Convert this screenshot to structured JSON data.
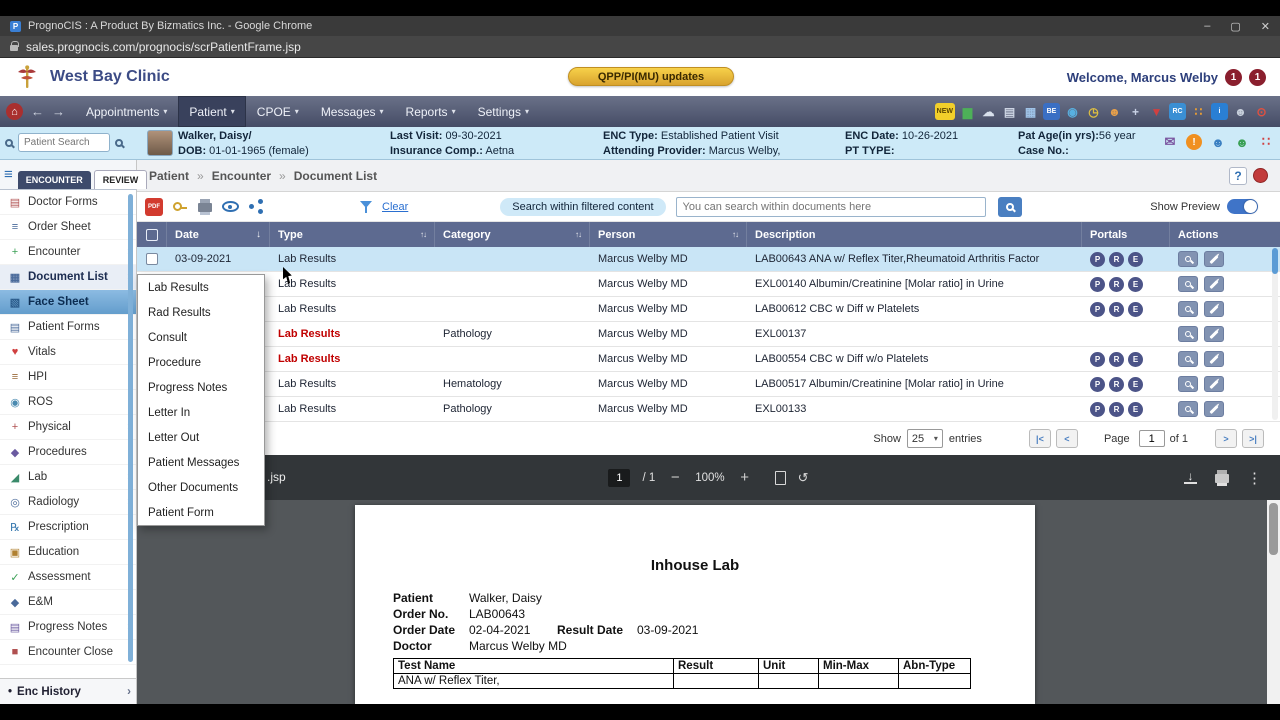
{
  "colors": {
    "brand_navy": "#3c4b85",
    "accent_blue": "#4a7fc1",
    "selection_blue": "#c9e5f6",
    "table_header": "#5d6a90",
    "alert_red": "#c00000",
    "portal_purple": "#4c5488",
    "qpp_yellow": "#e8b33a",
    "toggle_blue": "#3f74c8"
  },
  "chrome": {
    "title": "PrognoCIS : A Product By Bizmatics Inc. - Google Chrome",
    "url": "sales.prognocis.com/prognocis/scrPatientFrame.jsp",
    "minimize": "–",
    "maximize": "▢",
    "close": "✕"
  },
  "header": {
    "clinic_name": "West Bay Clinic",
    "qpp_button": "QPP/PI(MU) updates",
    "welcome": "Welcome, Marcus Welby",
    "badge1": "1",
    "badge2": "1"
  },
  "nav": {
    "items": [
      {
        "label": "Appointments",
        "active": false
      },
      {
        "label": "Patient",
        "active": true
      },
      {
        "label": "CPOE",
        "active": false
      },
      {
        "label": "Messages",
        "active": false
      },
      {
        "label": "Reports",
        "active": false
      },
      {
        "label": "Settings",
        "active": false
      }
    ],
    "icons": [
      {
        "name": "whats-new-icon",
        "glyph": "NEW",
        "color": "#5a4500",
        "bg": "#f2cf2a"
      },
      {
        "name": "charts-icon",
        "glyph": "▆",
        "color": "#4db058"
      },
      {
        "name": "cloud-icon",
        "glyph": "☁",
        "color": "#d8e0ec"
      },
      {
        "name": "compose-icon",
        "glyph": "▤",
        "color": "#cdd5e4"
      },
      {
        "name": "keyboard-icon",
        "glyph": "▦",
        "color": "#9fc3e8"
      },
      {
        "name": "billing-icon",
        "glyph": "BE",
        "color": "#ffffff",
        "bg": "#3a6fc4"
      },
      {
        "name": "globe-icon",
        "glyph": "◉",
        "color": "#58b0e0"
      },
      {
        "name": "clock-icon",
        "glyph": "◷",
        "color": "#e0c040"
      },
      {
        "name": "user-search-icon",
        "glyph": "☻",
        "color": "#e8a04a"
      },
      {
        "name": "immunization-icon",
        "glyph": "+",
        "color": "#c9d2e6"
      },
      {
        "name": "alert-icon",
        "glyph": "▼",
        "color": "#d04040"
      },
      {
        "name": "rcopia-icon",
        "glyph": "RC",
        "color": "#ffffff",
        "bg": "#3a8fd4"
      },
      {
        "name": "apps-icon",
        "glyph": "∷",
        "color": "#f0a030"
      },
      {
        "name": "info-icon",
        "glyph": "i",
        "color": "#ffffff",
        "bg": "#2a7fd4"
      },
      {
        "name": "support-icon",
        "glyph": "☻",
        "color": "#c8d0dc"
      },
      {
        "name": "logout-icon",
        "glyph": "⊙",
        "color": "#e05040"
      }
    ]
  },
  "patient_bar": {
    "search_placeholder": "Patient Search",
    "name": "Walker, Daisy/",
    "dob_label": "DOB:",
    "dob": "01-01-1965 (female)",
    "last_visit_label": "Last Visit:",
    "last_visit": "09-30-2021",
    "insurance_label": "Insurance Comp.:",
    "insurance": "Aetna",
    "enc_type_label": "ENC Type:",
    "enc_type": "Established Patient Visit",
    "attending_label": "Attending Provider:",
    "attending": "Marcus Welby,",
    "enc_date_label": "ENC Date:",
    "enc_date": "10-26-2021",
    "pt_type_label": "PT TYPE:",
    "pt_type": "",
    "pat_age_label": "Pat Age(in yrs):",
    "pat_age": "56 year",
    "case_no_label": "Case No.:",
    "case_no": "",
    "right_icons": [
      {
        "name": "fax-mail-icon",
        "glyph": "✉",
        "color": "#7a55a0"
      },
      {
        "name": "alerts-bell-icon",
        "glyph": "!",
        "color": "#ffffff",
        "bg": "#f09020"
      },
      {
        "name": "portal-user-icon",
        "glyph": "☻",
        "color": "#3a7fc1"
      },
      {
        "name": "add-user-icon",
        "glyph": "☻",
        "color": "#3aa055"
      },
      {
        "name": "quick-apps-icon",
        "glyph": "∷",
        "color": "#d04040"
      }
    ]
  },
  "sidebar": {
    "tabs": [
      "ENCOUNTER",
      "REVIEW"
    ],
    "items": [
      {
        "label": "Doctor Forms",
        "glyph": "▤",
        "color": "#b05050",
        "arrow": false,
        "selected": false,
        "highlight": false
      },
      {
        "label": "Order Sheet",
        "glyph": "≡",
        "color": "#4a6a9a",
        "arrow": false,
        "selected": false,
        "highlight": false
      },
      {
        "label": "Encounter",
        "glyph": "+",
        "color": "#3aa055",
        "arrow": true,
        "selected": false,
        "highlight": false
      },
      {
        "label": "Document List",
        "glyph": "▦",
        "color": "#4a6a9a",
        "arrow": true,
        "selected": true,
        "highlight": false
      },
      {
        "label": "Face Sheet",
        "glyph": "▧",
        "color": "#2a5a8a",
        "arrow": true,
        "selected": false,
        "highlight": true
      },
      {
        "label": "Patient Forms",
        "glyph": "▤",
        "color": "#4a6a9a",
        "arrow": false,
        "selected": false,
        "highlight": false
      },
      {
        "label": "Vitals",
        "glyph": "♥",
        "color": "#d04040",
        "arrow": false,
        "selected": false,
        "highlight": false
      },
      {
        "label": "HPI",
        "glyph": "≡",
        "color": "#9a6a3a",
        "arrow": false,
        "selected": false,
        "highlight": false
      },
      {
        "label": "ROS",
        "glyph": "◉",
        "color": "#4a8ab0",
        "arrow": false,
        "selected": false,
        "highlight": false
      },
      {
        "label": "Physical",
        "glyph": "+",
        "color": "#b05050",
        "arrow": true,
        "selected": false,
        "highlight": false
      },
      {
        "label": "Procedures",
        "glyph": "◆",
        "color": "#6a5aa0",
        "arrow": false,
        "selected": false,
        "highlight": false
      },
      {
        "label": "Lab",
        "glyph": "◢",
        "color": "#3a8a6a",
        "arrow": true,
        "selected": false,
        "highlight": false
      },
      {
        "label": "Radiology",
        "glyph": "◎",
        "color": "#4a6a9a",
        "arrow": true,
        "selected": false,
        "highlight": false
      },
      {
        "label": "Prescription",
        "glyph": "℞",
        "color": "#3a7ab0",
        "arrow": false,
        "selected": false,
        "highlight": false
      },
      {
        "label": "Education",
        "glyph": "▣",
        "color": "#b08030",
        "arrow": false,
        "selected": false,
        "highlight": false
      },
      {
        "label": "Assessment",
        "glyph": "✓",
        "color": "#3aa055",
        "arrow": false,
        "selected": false,
        "highlight": false
      },
      {
        "label": "E&M",
        "glyph": "◆",
        "color": "#4a6a9a",
        "arrow": false,
        "selected": false,
        "highlight": false
      },
      {
        "label": "Progress Notes",
        "glyph": "▤",
        "color": "#6a5aa0",
        "arrow": true,
        "selected": false,
        "highlight": false
      },
      {
        "label": "Encounter Close",
        "glyph": "■",
        "color": "#b05050",
        "arrow": false,
        "selected": false,
        "highlight": false
      }
    ],
    "enc_history": "Enc History"
  },
  "breadcrumb": {
    "parts": [
      "Patient",
      "Encounter",
      "Document List"
    ],
    "separator": "»",
    "help": "?"
  },
  "filter_bar": {
    "clear": "Clear",
    "search_label": "Search within filtered content",
    "search_placeholder": "You can search within documents here",
    "show_preview": "Show Preview"
  },
  "table": {
    "headers": [
      "Date",
      "Type",
      "Category",
      "Person",
      "Description",
      "Portals",
      "Actions"
    ],
    "portal_letters": [
      "P",
      "R",
      "E"
    ],
    "rows": [
      {
        "date": "03-09-2021",
        "type": "Lab Results",
        "category": "",
        "person": "Marcus Welby MD",
        "description": "LAB00643 ANA w/ Reflex Titer,Rheumatoid Arthritis Factor",
        "portals": true,
        "red": false,
        "selected": true
      },
      {
        "date": "",
        "type": "Lab Results",
        "category": "",
        "person": "Marcus Welby MD",
        "description": "EXL00140 Albumin/Creatinine [Molar ratio] in Urine",
        "portals": true,
        "red": false,
        "selected": false
      },
      {
        "date": "",
        "type": "Lab Results",
        "category": "",
        "person": "Marcus Welby MD",
        "description": "LAB00612 CBC w Diff w Platelets",
        "portals": true,
        "red": false,
        "selected": false
      },
      {
        "date": "",
        "type": "Lab Results",
        "category": "Pathology",
        "person": "Marcus Welby MD",
        "description": "EXL00137",
        "portals": false,
        "red": true,
        "selected": false
      },
      {
        "date": "",
        "type": "Lab Results",
        "category": "",
        "person": "Marcus Welby MD",
        "description": "LAB00554 CBC w Diff w/o Platelets",
        "portals": true,
        "red": true,
        "selected": false
      },
      {
        "date": "",
        "type": "Lab Results",
        "category": "Hematology",
        "person": "Marcus Welby MD",
        "description": "LAB00517 Albumin/Creatinine [Molar ratio] in Urine",
        "portals": true,
        "red": false,
        "selected": false
      },
      {
        "date": "",
        "type": "Lab Results",
        "category": "Pathology",
        "person": "Marcus Welby MD",
        "description": "EXL00133",
        "portals": true,
        "red": false,
        "selected": false
      }
    ]
  },
  "dropdown": {
    "items": [
      "Lab Results",
      "Rad Results",
      "Consult",
      "Procedure",
      "Progress Notes",
      "Letter In",
      "Letter Out",
      "Patient Messages",
      "Other Documents",
      "Patient Form"
    ]
  },
  "pagination": {
    "show_label": "Show",
    "entries_value": "25",
    "entries_label": "entries",
    "page_label": "Page",
    "page_value": "1",
    "of_label": "of 1",
    "first": "|<",
    "prev": "<",
    "next": ">",
    "last": ">|"
  },
  "pdf_viewer": {
    "url_fragment": ".jsp",
    "page": "1",
    "page_total": "/ 1",
    "zoom_out": "−",
    "zoom": "100%",
    "zoom_in": "+",
    "doc": {
      "title": "Inhouse Lab",
      "patient_label": "Patient",
      "patient": "Walker, Daisy",
      "order_no_label": "Order No.",
      "order_no": "LAB00643",
      "order_date_label": "Order Date",
      "order_date": "02-04-2021",
      "result_date_label": "Result Date",
      "result_date": "03-09-2021",
      "doctor_label": "Doctor",
      "doctor": "Marcus Welby MD",
      "table_headers": [
        "Test Name",
        "Result",
        "Unit",
        "Min-Max",
        "Abn-Type"
      ],
      "partial_row": "ANA w/ Reflex Titer,"
    }
  }
}
